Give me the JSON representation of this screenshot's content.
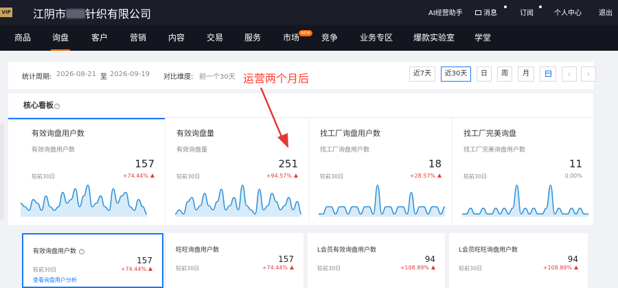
{
  "header": {
    "vip_badge": "VIP版",
    "shop_prefix": "江阴市",
    "shop_suffix": "针织有限公司",
    "ai_assistant": "AI经营助手",
    "message": "消息",
    "subscribe": "订阅",
    "personal_center": "个人中心",
    "logout": "退出"
  },
  "nav": {
    "items": [
      "商品",
      "询盘",
      "客户",
      "营销",
      "内容",
      "交易",
      "服务",
      "市场",
      "竞争",
      "业务专区",
      "爆款实验室",
      "学堂"
    ],
    "active_index": 1,
    "new_badge": "NEW"
  },
  "filter": {
    "period_label": "统计周期:",
    "start_date": "2026-08-21",
    "to": "至",
    "end_date": "2026-09-19",
    "compare_label": "对比维度:",
    "compare_value": "前一个30天",
    "buttons": [
      "近7天",
      "近30天",
      "日",
      "周",
      "月"
    ],
    "selected": "近30天",
    "prev": "‹",
    "next": "›"
  },
  "annotation": "运营两个月后",
  "core": {
    "title": "核心看板",
    "help": "?",
    "compare_text": "较前30日",
    "cards": [
      {
        "title": "有效询盘用户数",
        "subtitle": "有效询盘用户数",
        "value": "157",
        "change": "+74.44%",
        "trend": [
          4,
          3,
          2,
          5,
          4,
          2,
          6,
          3,
          2,
          3,
          7,
          4,
          5,
          8,
          3,
          6,
          9,
          3,
          4,
          6,
          3,
          2,
          8,
          4,
          6,
          7,
          3,
          2,
          5,
          3,
          1
        ]
      },
      {
        "title": "有效询盘量",
        "subtitle": "有效询盘量",
        "value": "251",
        "change": "+94.57%",
        "trend": [
          2,
          3,
          2,
          5,
          6,
          3,
          4,
          7,
          4,
          3,
          5,
          8,
          3,
          4,
          6,
          3,
          9,
          4,
          3,
          2,
          8,
          3,
          4,
          7,
          5,
          3,
          4,
          6,
          3,
          5,
          2
        ]
      },
      {
        "title": "找工厂询盘用户数",
        "subtitle": "找工厂询盘用户数",
        "value": "18",
        "change": "+28.57%",
        "trend": [
          0,
          0,
          1,
          1,
          0,
          1,
          1,
          0,
          1,
          1,
          0,
          1,
          1,
          0,
          4,
          0,
          1,
          1,
          0,
          1,
          1,
          0,
          3,
          0,
          1,
          1,
          0,
          1,
          1,
          0,
          1
        ]
      },
      {
        "title": "找工厂完美询盘",
        "subtitle": "找工厂完美询盘用户数",
        "value": "11",
        "change": "0.00%",
        "trend": [
          0,
          0,
          1,
          0,
          0,
          1,
          0,
          0,
          1,
          0,
          1,
          0,
          1,
          5,
          0,
          1,
          0,
          1,
          0,
          0,
          1,
          5,
          0,
          1,
          0,
          0,
          1,
          0,
          1,
          0,
          0
        ]
      }
    ]
  },
  "bottom_cards": [
    {
      "title": "有效询盘用户数",
      "value": "157",
      "change": "+74.44%",
      "link": "查看询盘用户分析"
    },
    {
      "title": "旺旺询盘用户数",
      "value": "157",
      "change": "+74.44%"
    },
    {
      "title": "L会员有效询盘用户数",
      "value": "94",
      "change": "+108.89%"
    },
    {
      "title": "L会员旺旺询盘用户数",
      "value": "94",
      "change": "+108.89%"
    }
  ],
  "colors": {
    "accent": "#1677ff",
    "up": "#e53935",
    "nav_active": "#ff6a00",
    "spark": "#2a90d6",
    "spark_fill": "#d8ebf8"
  }
}
